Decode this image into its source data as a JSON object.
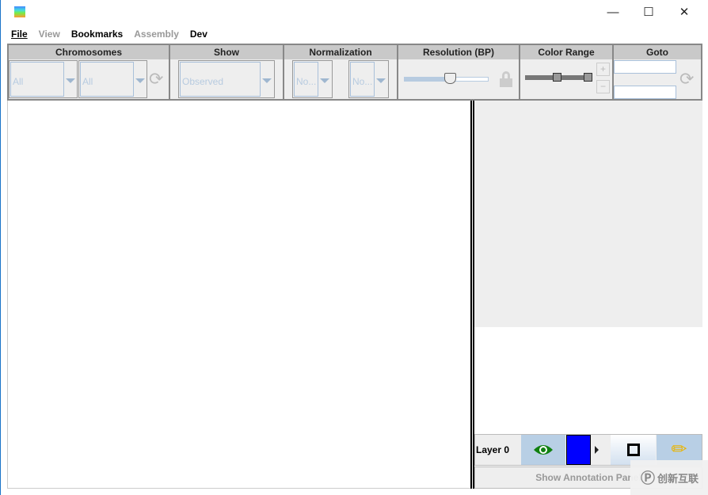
{
  "menu": {
    "items": [
      {
        "label": "File",
        "enabled": true
      },
      {
        "label": "View",
        "enabled": false
      },
      {
        "label": "Bookmarks",
        "enabled": true
      },
      {
        "label": "Assembly",
        "enabled": false
      },
      {
        "label": "Dev",
        "enabled": true
      }
    ]
  },
  "toolbar": {
    "chromosomes": {
      "label": "Chromosomes",
      "first": "All",
      "second": "All"
    },
    "show": {
      "label": "Show",
      "value": "Observed"
    },
    "normalization": {
      "label": "Normalization",
      "first": "No...",
      "second": "No..."
    },
    "resolution": {
      "label": "Resolution (BP)",
      "slider_fraction": 0.55
    },
    "color_range": {
      "label": "Color Range"
    },
    "goto": {
      "label": "Goto",
      "first": "",
      "second": ""
    }
  },
  "layer": {
    "name": "Layer 0",
    "color": "#0000ff"
  },
  "annotation_button": "Show Annotation Panel",
  "watermark": "创新互联"
}
